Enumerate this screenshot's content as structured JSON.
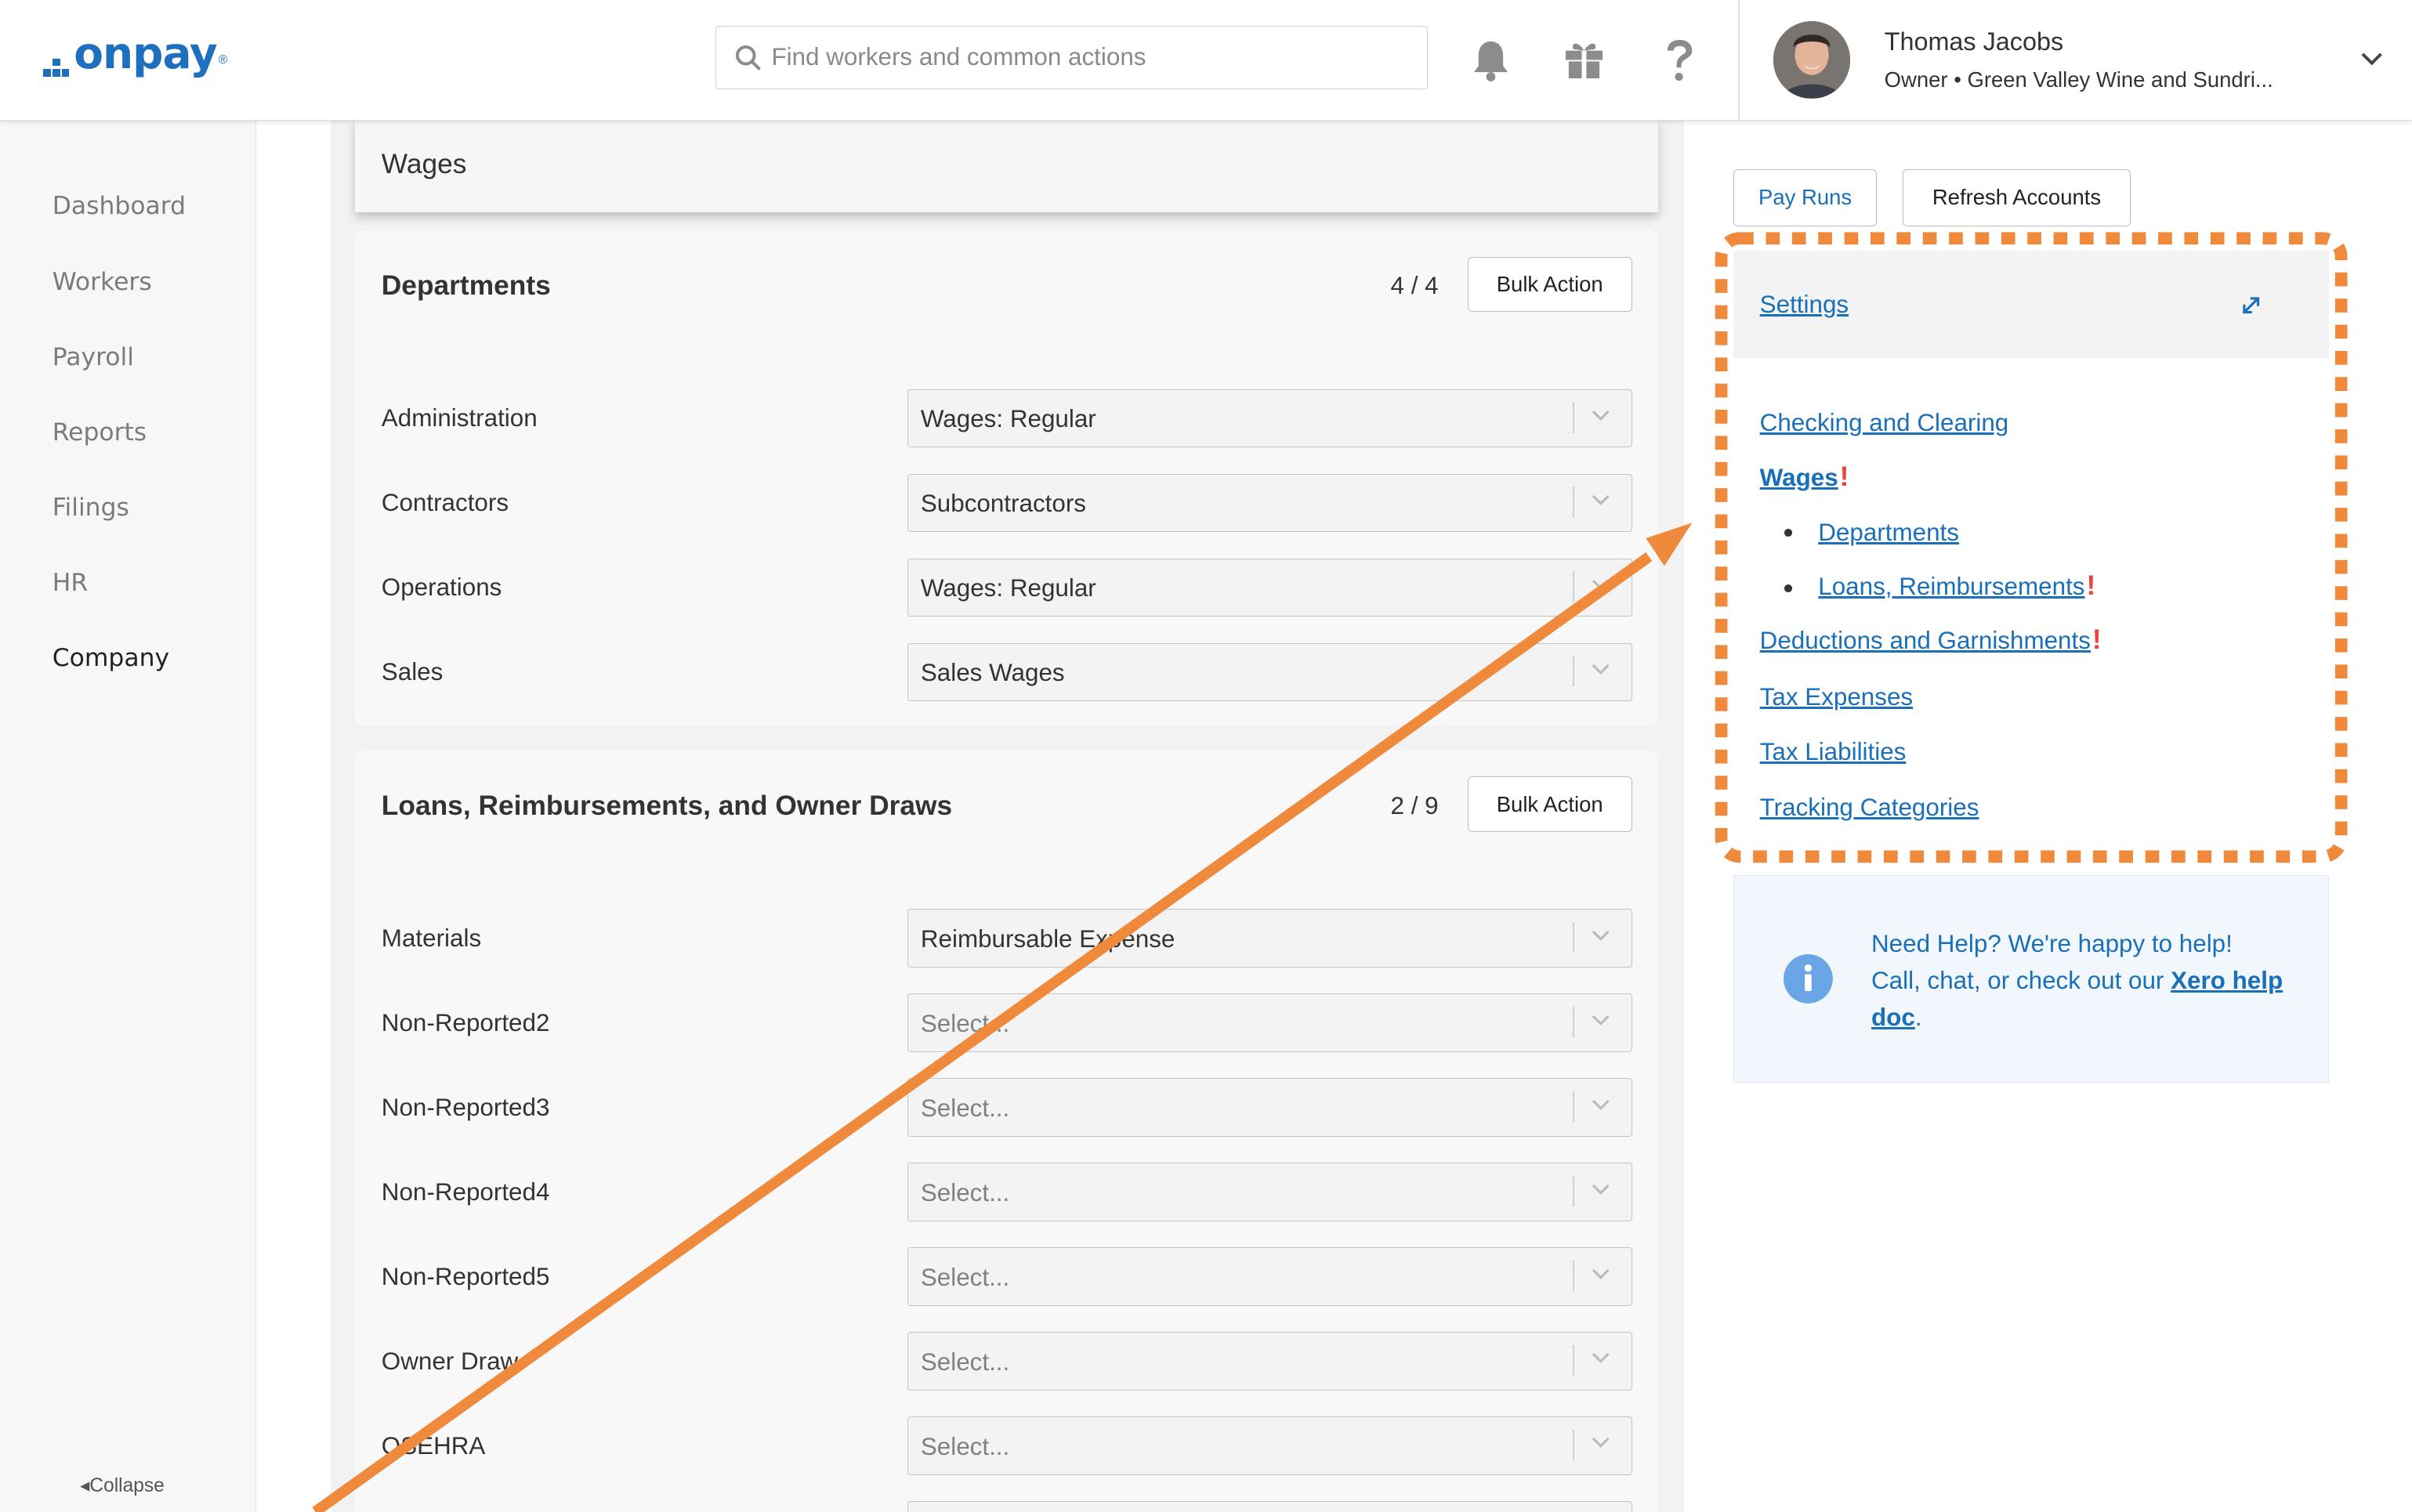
{
  "header": {
    "logo_text": "onpay",
    "logo_mark": "®",
    "search": {
      "placeholder": "Find workers and common actions",
      "value": ""
    },
    "icons": [
      "bell-icon",
      "gift-icon",
      "help-icon"
    ],
    "user": {
      "name": "Thomas Jacobs",
      "role": "Owner • Green Valley Wine and Sundri..."
    }
  },
  "sidebar": {
    "items": [
      {
        "label": "Dashboard",
        "active": false
      },
      {
        "label": "Workers",
        "active": false
      },
      {
        "label": "Payroll",
        "active": false
      },
      {
        "label": "Reports",
        "active": false
      },
      {
        "label": "Filings",
        "active": false
      },
      {
        "label": "HR",
        "active": false
      },
      {
        "label": "Company",
        "active": true
      }
    ],
    "collapse_label": "Collapse"
  },
  "main": {
    "wages_title": "Wages",
    "departments": {
      "title": "Departments",
      "count": "4 / 4",
      "bulk_label": "Bulk Action",
      "rows": [
        {
          "label": "Administration",
          "value": "Wages: Regular"
        },
        {
          "label": "Contractors",
          "value": "Subcontractors"
        },
        {
          "label": "Operations",
          "value": "Wages: Regular"
        },
        {
          "label": "Sales",
          "value": "Sales Wages"
        }
      ]
    },
    "loans": {
      "title": "Loans, Reimbursements, and Owner Draws",
      "count": "2 / 9",
      "bulk_label": "Bulk Action",
      "rows": [
        {
          "label": "Materials",
          "value": "Reimbursable Expense"
        },
        {
          "label": "Non-Reported2",
          "value": "Select..."
        },
        {
          "label": "Non-Reported3",
          "value": "Select..."
        },
        {
          "label": "Non-Reported4",
          "value": "Select..."
        },
        {
          "label": "Non-Reported5",
          "value": "Select..."
        },
        {
          "label": "Owner Draw",
          "value": "Select..."
        },
        {
          "label": "QSEHRA",
          "value": "Select..."
        }
      ]
    }
  },
  "right": {
    "pay_runs_label": "Pay Runs",
    "refresh_label": "Refresh Accounts",
    "settings_label": "Settings",
    "nav": {
      "checking": "Checking and Clearing",
      "wages": "Wages",
      "departments": "Departments",
      "loans": "Loans, Reimbursements",
      "deductions": "Deductions and Garnishments",
      "tax_expenses": "Tax Expenses",
      "tax_liabilities": "Tax Liabilities",
      "tracking": "Tracking Categories"
    },
    "alert_mark": "!",
    "help": {
      "line1": "Need Help? We're happy to help!",
      "line2": "Call, chat, or check out our",
      "link": "Xero help doc",
      "end": "."
    }
  },
  "annotation": {
    "highlight_color": "#ef8a3c"
  }
}
